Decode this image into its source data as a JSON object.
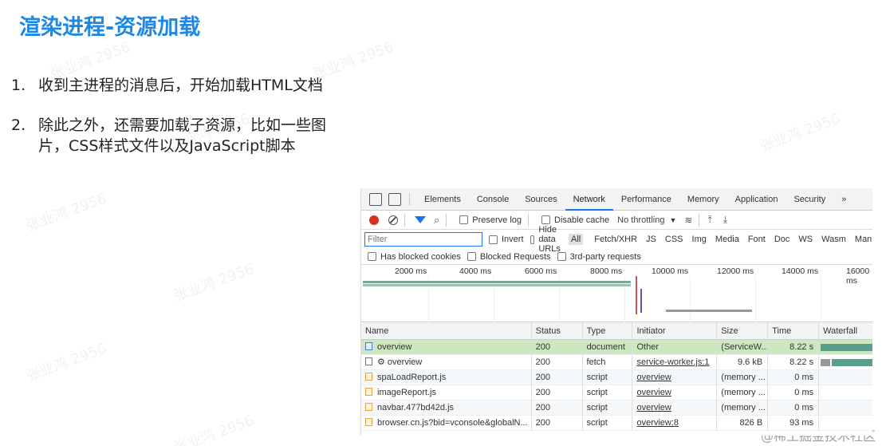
{
  "slide": {
    "title": "渲染进程-资源加载",
    "points": [
      {
        "num": "1.",
        "text": "收到主进程的消息后，开始加载HTML文档"
      },
      {
        "num": "2.",
        "text": "除此之外，还需要加载子资源，比如一些图片，CSS样式文件以及JavaScript脚本"
      }
    ],
    "watermark": "张业鸿 2956",
    "footer": "@稀土掘金技术社区"
  },
  "devtools": {
    "tabs": [
      "Elements",
      "Console",
      "Sources",
      "Network",
      "Performance",
      "Memory",
      "Application",
      "Security",
      "»"
    ],
    "active_tab": "Network",
    "toolbar": {
      "preserve_log": "Preserve log",
      "disable_cache": "Disable cache",
      "throttling": "No throttling"
    },
    "filter": {
      "placeholder": "Filter",
      "invert": "Invert",
      "hide_data_urls": "Hide data URLs",
      "types": [
        "All",
        "Fetch/XHR",
        "JS",
        "CSS",
        "Img",
        "Media",
        "Font",
        "Doc",
        "WS",
        "Wasm",
        "Man"
      ]
    },
    "blocked": [
      "Has blocked cookies",
      "Blocked Requests",
      "3rd-party requests"
    ],
    "timeline_ticks": [
      "2000 ms",
      "4000 ms",
      "6000 ms",
      "8000 ms",
      "10000 ms",
      "12000 ms",
      "14000 ms",
      "16000 ms"
    ],
    "columns": [
      "Name",
      "Status",
      "Type",
      "Initiator",
      "Size",
      "Time",
      "Waterfall"
    ],
    "rows": [
      {
        "icon": "doc",
        "name": "overview",
        "status": "200",
        "type": "document",
        "initiator": "Other",
        "initiator_link": false,
        "size": "(ServiceW...",
        "time": "8.22 s",
        "wf_color": "#5a9e8f"
      },
      {
        "icon": "fetch",
        "name": "⚙ overview",
        "status": "200",
        "type": "fetch",
        "initiator": "service-worker.js:1",
        "initiator_link": true,
        "size": "9.6 kB",
        "time": "8.22 s",
        "wf_color": "#5a9e8f"
      },
      {
        "icon": "script",
        "name": "spaLoadReport.js",
        "status": "200",
        "type": "script",
        "initiator": "overview",
        "initiator_link": true,
        "size": "(memory ...",
        "time": "0 ms",
        "wf_color": ""
      },
      {
        "icon": "script",
        "name": "imageReport.js",
        "status": "200",
        "type": "script",
        "initiator": "overview",
        "initiator_link": true,
        "size": "(memory ...",
        "time": "0 ms",
        "wf_color": ""
      },
      {
        "icon": "script",
        "name": "navbar.477bd42d.js",
        "status": "200",
        "type": "script",
        "initiator": "overview",
        "initiator_link": true,
        "size": "(memory ...",
        "time": "0 ms",
        "wf_color": ""
      },
      {
        "icon": "script",
        "name": "browser.cn.js?bid=vconsole&globalN...",
        "status": "200",
        "type": "script",
        "initiator": "overview:8",
        "initiator_link": true,
        "size": "826 B",
        "time": "93 ms",
        "wf_color": ""
      }
    ]
  }
}
